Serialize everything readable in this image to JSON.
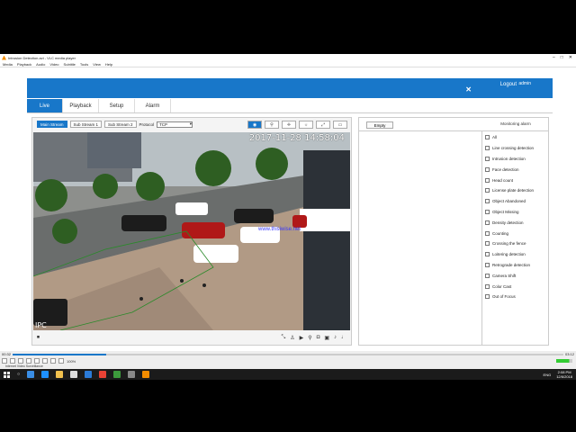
{
  "vlc": {
    "title": "Intrusion Detection.avi - VLC media player",
    "menu": [
      "Media",
      "Playback",
      "Audio",
      "Video",
      "Subtitle",
      "Tools",
      "View",
      "Help"
    ],
    "time_elapsed": "00:32",
    "time_total": "03:12",
    "progress": 0.17,
    "volume": "100%",
    "status": "Internet Video Surveillance"
  },
  "app": {
    "logout_label": "Logout",
    "user": "admin",
    "tabs": [
      {
        "label": "Live",
        "active": true
      },
      {
        "label": "Playback",
        "active": false
      },
      {
        "label": "Setup",
        "active": false
      },
      {
        "label": "Alarm",
        "active": false
      }
    ],
    "streams": [
      {
        "label": "Main Stream",
        "active": true
      },
      {
        "label": "Sub Stream 1",
        "active": false
      },
      {
        "label": "Sub Stream 2",
        "active": false
      }
    ],
    "protocol_label": "Protocol",
    "protocol_value": "TCP",
    "video_tools": [
      "view-icon",
      "zoom-icon",
      "ptz-icon",
      "image-icon",
      "fullscreen-icon",
      "window-icon"
    ],
    "osd_time": "2017-11-28 14:58:04",
    "osd_channel": "IPC",
    "watermark": "www.thisiwise.net",
    "alarm_panel": {
      "empty_label": "Empty",
      "header": "Monitoring alarm",
      "items": [
        "All",
        "Line crossing detection",
        "Intrusion detection",
        "Face detection",
        "Head count",
        "License plate detection",
        "Object Abandoned",
        "Object Missing",
        "Density detection",
        "Counting",
        "Crossing the fence",
        "Loitering detection",
        "Retrograde detection",
        "Camera Shift",
        "Color Cast",
        "Out of Focus"
      ]
    }
  },
  "taskbar": {
    "lang": "ENG",
    "time": "2:08 PM",
    "date": "12/6/2018"
  },
  "colors": {
    "accent": "#1877c9"
  }
}
